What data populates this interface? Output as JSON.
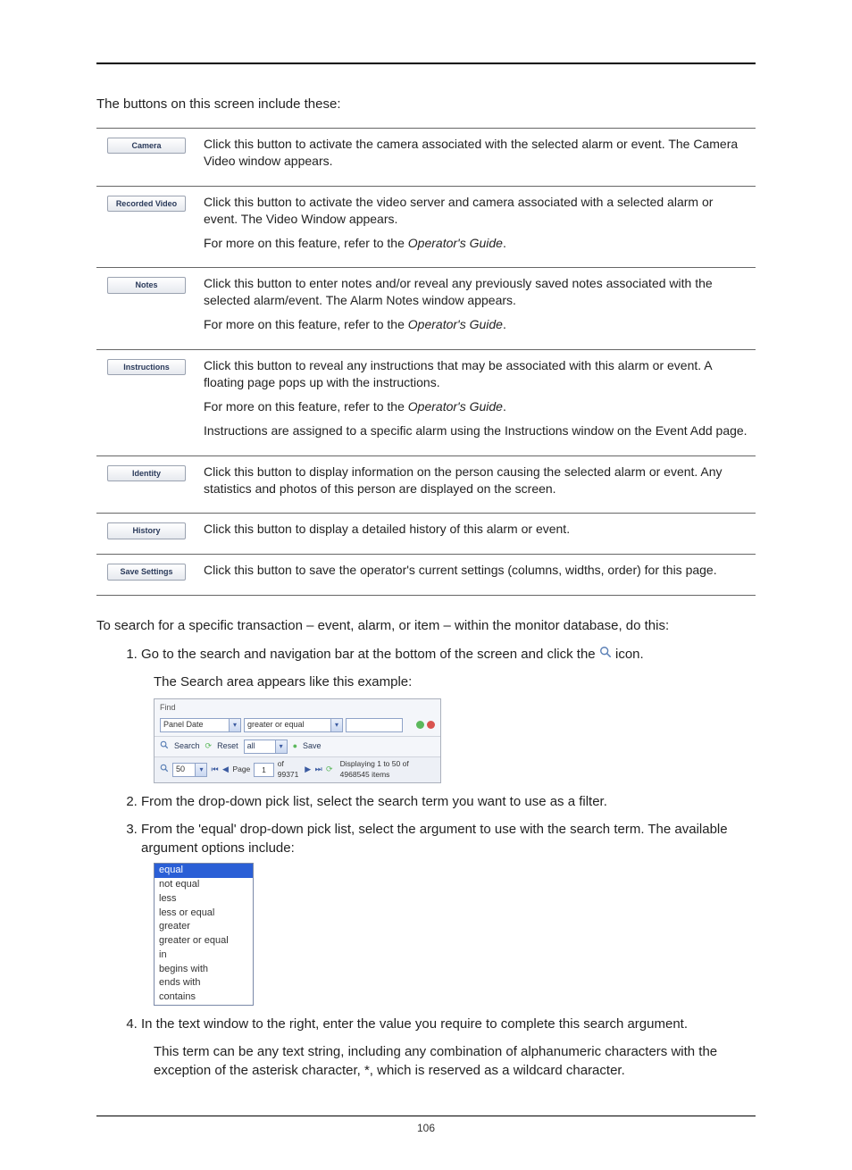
{
  "intro": "The buttons on this screen include these:",
  "buttons": [
    {
      "label": "Camera",
      "desc": [
        "Click this button to activate the camera associated with the selected alarm or event. The Camera Video window appears."
      ]
    },
    {
      "label": "Recorded Video",
      "desc": [
        "Click this button to activate the video server and camera associated with a selected alarm or event. The Video Window appears.",
        "For more on this feature, refer to the <i>Operator's Guide</i>."
      ]
    },
    {
      "label": "Notes",
      "desc": [
        "Click this button to enter notes and/or reveal any previously saved notes associated with the selected alarm/event. The Alarm Notes window appears.",
        "For more on this feature, refer to the <i>Operator's Guide</i>."
      ]
    },
    {
      "label": "Instructions",
      "desc": [
        "Click this button to reveal any instructions that may be associated with this alarm or event. A floating page pops up with the instructions.",
        "For more on this feature, refer to the <i>Operator's Guide</i>.",
        "Instructions are assigned to a specific alarm using the Instructions window on the Event Add page."
      ]
    },
    {
      "label": "Identity",
      "desc": [
        "Click this button to display information on the person causing the selected alarm or event. Any statistics and photos of this person are displayed on the screen."
      ]
    },
    {
      "label": "History",
      "desc": [
        "Click this button to display a detailed history of this alarm or event."
      ]
    },
    {
      "label": "Save Settings",
      "desc": [
        "Click this button to save the operator's current settings (columns, widths, order) for this page."
      ]
    }
  ],
  "searchIntro": "To search for a specific transaction – event, alarm, or item – within the monitor database, do this:",
  "steps": {
    "s1a": "Go to the search and navigation bar at the bottom of the screen and click the ",
    "s1b": " icon.",
    "s1sub": "The Search area appears like this example:",
    "s2": "From the drop-down pick list, select the search term you want to use as a filter.",
    "s3": "From the 'equal' drop-down pick list,  select the argument to use with the search term. The available argument options include:",
    "s4a": "In the text window to the right, enter the value you require to complete this search argument.",
    "s4b": "This term can be any text string, including any combination of alphanumeric characters with the exception of the asterisk character, *, which is reserved as a wildcard character."
  },
  "find": {
    "title": "Find",
    "dd1": "Panel Date",
    "dd2": "greater or equal",
    "search": "Search",
    "reset": "Reset",
    "ddall": "all",
    "save": "Save",
    "pagesize": "50",
    "pagelabel": "Page",
    "pagenum": "1",
    "ofcount": "of 99371",
    "status": "Displaying 1 to 50 of 4968545 items"
  },
  "args": [
    "equal",
    "not equal",
    "less",
    "less or equal",
    "greater",
    "greater or equal",
    "in",
    "begins with",
    "ends with",
    "contains"
  ],
  "pageNumber": "106"
}
